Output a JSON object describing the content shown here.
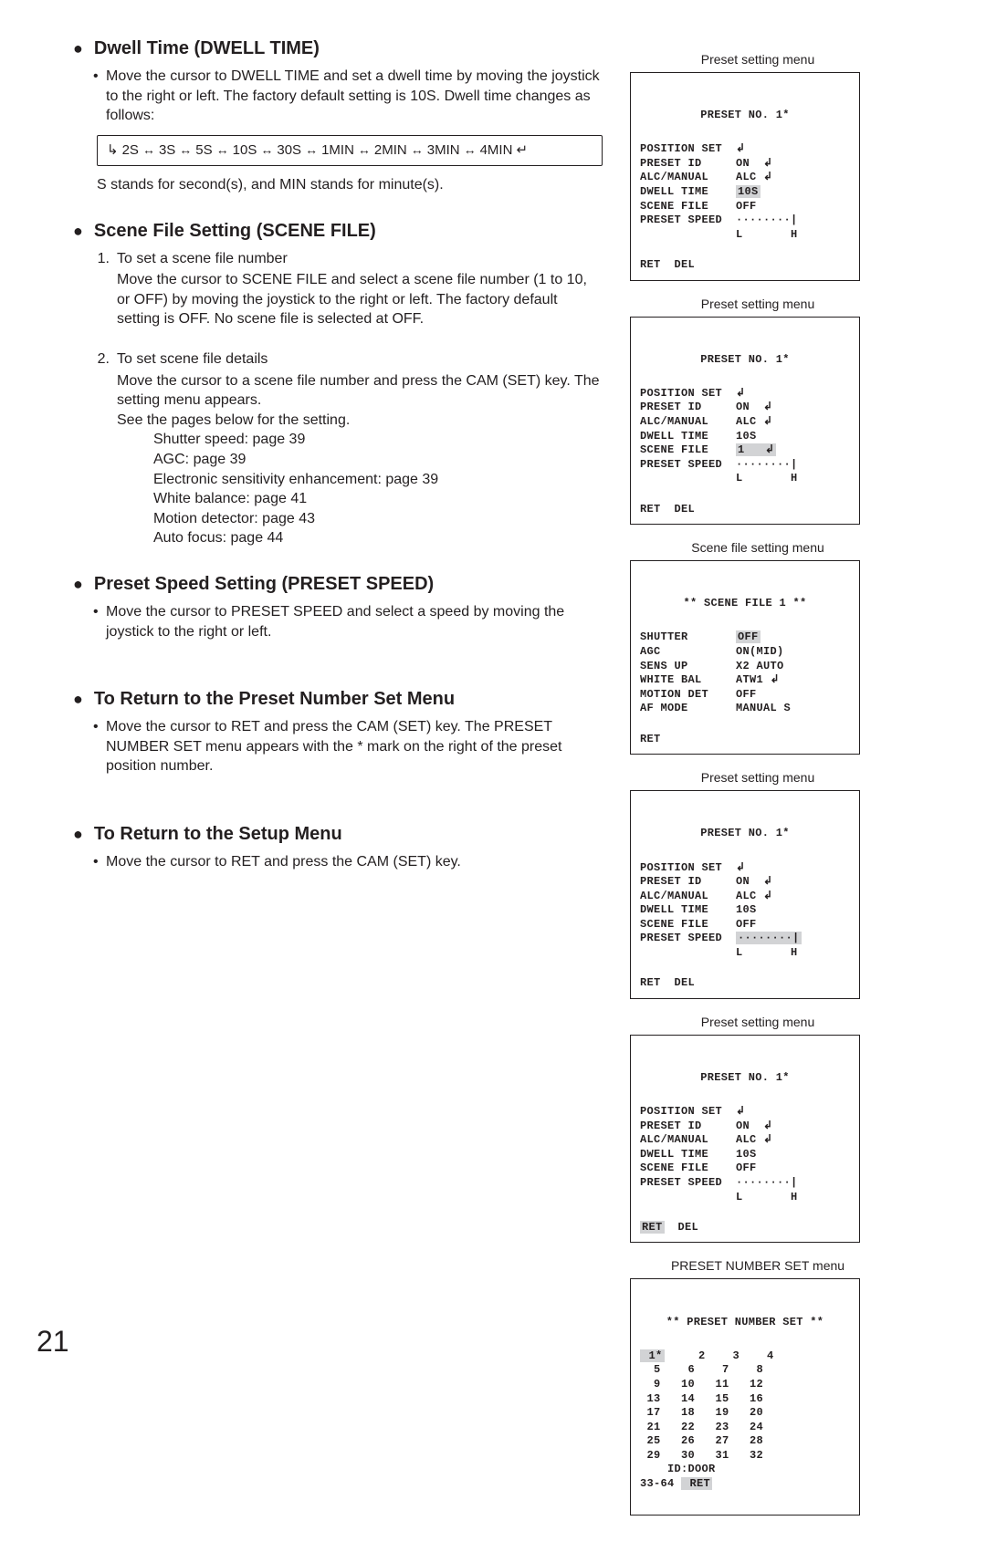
{
  "pageNumber": "21",
  "dwell": {
    "title": "Dwell Time (DWELL TIME)",
    "body": "Move the cursor to DWELL TIME and set a dwell time by moving the joystick to the right or left. The factory default setting is 10S. Dwell time changes as follows:",
    "seq": [
      "2S",
      "3S",
      "5S",
      "10S",
      "30S",
      "1MIN",
      "2MIN",
      "3MIN",
      "4MIN"
    ],
    "note": "S stands for second(s), and MIN stands for minute(s)."
  },
  "sceneFile": {
    "title": "Scene File Setting (SCENE FILE)",
    "item1_head": "To set a scene file number",
    "item1_body": "Move the cursor to SCENE FILE and select a scene file number (1 to 10, or OFF) by moving the joystick to the right or left. The factory default setting is OFF. No scene file is selected at OFF.",
    "item2_head": "To set scene file details",
    "item2_body1": "Move the cursor to a scene file number and press the CAM (SET) key. The setting menu appears.",
    "item2_body2": "See the pages below for the setting.",
    "refs": [
      "Shutter speed: page 39",
      "AGC: page 39",
      "Electronic sensitivity enhancement: page 39",
      "White balance: page 41",
      "Motion detector: page 43",
      "Auto focus: page 44"
    ]
  },
  "presetSpeed": {
    "title": "Preset Speed Setting (PRESET SPEED)",
    "body": "Move the cursor to PRESET SPEED and select a speed by moving the joystick to the right or left."
  },
  "returnPreset": {
    "title": "To Return to the Preset Number Set Menu",
    "body": "Move the cursor to RET and press the CAM (SET) key. The PRESET NUMBER SET menu appears with the * mark on the right of the preset position number."
  },
  "returnSetup": {
    "title": "To Return to the Setup Menu",
    "body": "Move the cursor to RET and press the CAM (SET) key."
  },
  "captions": {
    "presetSetting": "Preset setting menu",
    "sceneFileSetting": "Scene file setting menu",
    "presetNumberSet": "PRESET NUMBER SET menu"
  },
  "osd1": {
    "title": "PRESET NO. 1*",
    "l1": "POSITION SET  ↲",
    "l2": "PRESET ID     ON  ↲",
    "l3": "ALC/MANUAL    ALC ↲",
    "l5": "SCENE FILE    OFF",
    "l6": "PRESET SPEED  ········|",
    "l7": "              L       H",
    "footer": "RET  DEL",
    "dwell_label": "DWELL TIME    ",
    "dwell_val": "10S"
  },
  "osd2": {
    "title": "PRESET NO. 1*",
    "l1": "POSITION SET  ↲",
    "l2": "PRESET ID     ON  ↲",
    "l3": "ALC/MANUAL    ALC ↲",
    "l4": "DWELL TIME    10S",
    "l6": "PRESET SPEED  ········|",
    "l7": "              L       H",
    "footer": "RET  DEL",
    "scene_label": "SCENE FILE    ",
    "scene_val": "1   ↲"
  },
  "osd3": {
    "title": "** SCENE FILE 1 **",
    "shutter_label": "SHUTTER       ",
    "shutter_val": "OFF",
    "l2": "AGC           ON(MID)",
    "l3": "SENS UP       X2 AUTO",
    "l4": "WHITE BAL     ATW1 ↲",
    "l5": "MOTION DET    OFF",
    "l6": "AF MODE       MANUAL S",
    "footer": "RET"
  },
  "osd4": {
    "title": "PRESET NO. 1*",
    "l1": "POSITION SET  ↲",
    "l2": "PRESET ID     ON  ↲",
    "l3": "ALC/MANUAL    ALC ↲",
    "l4": "DWELL TIME    10S",
    "l5": "SCENE FILE    OFF",
    "l7": "              L       H",
    "footer": "RET  DEL",
    "speed_label": "PRESET SPEED  ",
    "speed_val": "········|"
  },
  "osd5": {
    "title": "PRESET NO. 1*",
    "l1": "POSITION SET  ↲",
    "l2": "PRESET ID     ON  ↲",
    "l3": "ALC/MANUAL    ALC ↲",
    "l4": "DWELL TIME    10S",
    "l5": "SCENE FILE    OFF",
    "l6": "PRESET SPEED  ········|",
    "l7": "              L       H",
    "ret": "RET",
    "del": "  DEL"
  },
  "osd6": {
    "title": "** PRESET NUMBER SET **",
    "cur": " 1*",
    "r1": "     2    3    4",
    "r2": "  5    6    7    8",
    "r3": "  9   10   11   12",
    "r4": " 13   14   15   16",
    "r5": " 17   18   19   20",
    "r6": " 21   22   23   24",
    "r7": " 25   26   27   28",
    "r8": " 29   30   31   32",
    "id": "    ID:DOOR",
    "range": "33-64 ",
    "ret": " RET"
  }
}
